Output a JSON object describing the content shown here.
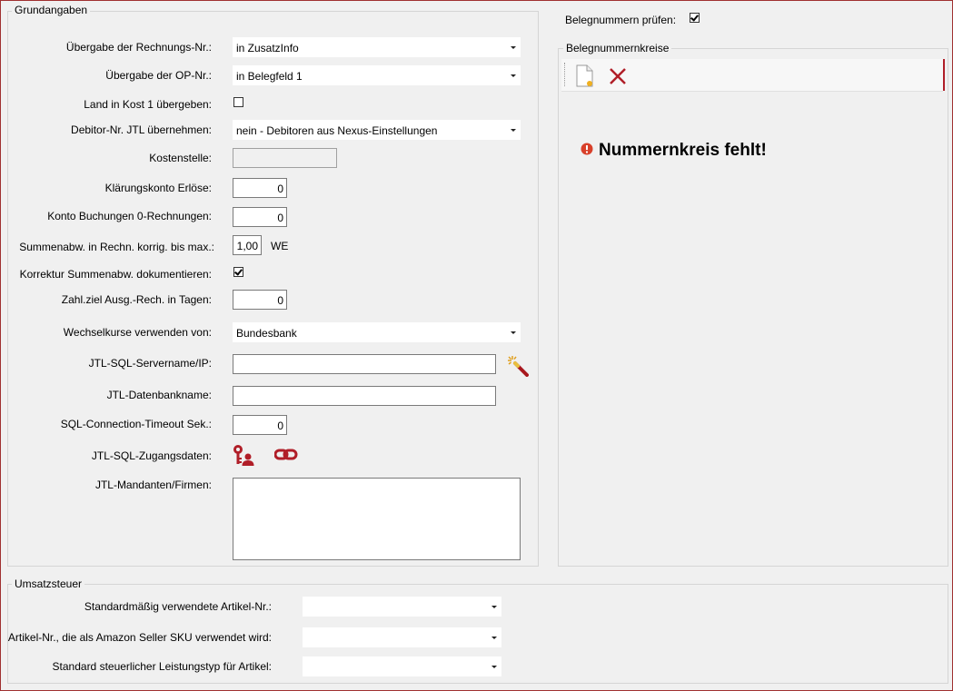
{
  "grundangaben": {
    "title": "Grundangaben",
    "rechnungs_nr_label": "Übergabe der Rechnungs-Nr.:",
    "rechnungs_nr_value": "in ZusatzInfo",
    "op_nr_label": "Übergabe der OP-Nr.:",
    "op_nr_value": "in Belegfeld 1",
    "land_label": "Land in Kost 1 übergeben:",
    "land_checked": false,
    "debitor_label": "Debitor-Nr. JTL übernehmen:",
    "debitor_value": "nein - Debitoren aus Nexus-Einstellungen",
    "kostenstelle_label": "Kostenstelle:",
    "kostenstelle_value": "",
    "klaerungskonto_label": "Klärungskonto Erlöse:",
    "klaerungskonto_value": "0",
    "konto0_label": "Konto Buchungen 0-Rechnungen:",
    "konto0_value": "0",
    "summenabw_label": "Summenabw. in Rechn. korrig. bis max.:",
    "summenabw_value": "1,00",
    "summenabw_unit": "WE",
    "korrektur_label": "Korrektur Summenabw. dokumentieren:",
    "korrektur_checked": true,
    "zahlziel_label": "Zahl.ziel Ausg.-Rech. in Tagen:",
    "zahlziel_value": "0",
    "wechselkurse_label": "Wechselkurse verwenden von:",
    "wechselkurse_value": "Bundesbank",
    "servername_label": "JTL-SQL-Servername/IP:",
    "servername_value": "",
    "datenbank_label": "JTL-Datenbankname:",
    "datenbank_value": "",
    "timeout_label": "SQL-Connection-Timeout Sek.:",
    "timeout_value": "0",
    "zugangsdaten_label": "JTL-SQL-Zugangsdaten:",
    "mandanten_label": "JTL-Mandanten/Firmen:"
  },
  "belegnummern": {
    "pruefen_label": "Belegnummern prüfen:",
    "pruefen_checked": true,
    "kreise_title": "Belegnummernkreise",
    "error_text": "Nummernkreis fehlt!"
  },
  "umsatzsteuer": {
    "title": "Umsatzsteuer",
    "artikel_label": "Standardmäßig verwendete Artikel-Nr.:",
    "artikel_value": "",
    "sku_label": "Artikel-Nr., die als Amazon Seller SKU verwendet wird:",
    "sku_value": "",
    "leistungstyp_label": "Standard steuerlicher Leistungstyp für Artikel:",
    "leistungstyp_value": ""
  },
  "icons": {
    "wand": "magic-wand-icon",
    "key_user": "key-user-icon",
    "link": "link-icon",
    "new_doc": "new-document-icon",
    "delete": "delete-x-icon",
    "error": "error-icon"
  },
  "colors": {
    "accent_red": "#b01e28",
    "frame_border": "#a03030",
    "background": "#f0f0f0"
  }
}
